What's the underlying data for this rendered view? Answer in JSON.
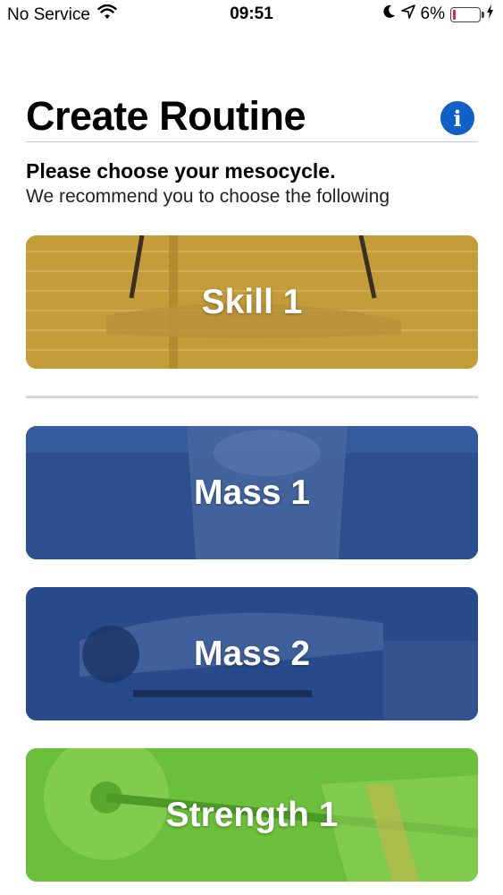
{
  "status_bar": {
    "carrier": "No Service",
    "time": "09:51",
    "battery_percent": "6%",
    "battery_level": 0.06
  },
  "header": {
    "title": "Create Routine"
  },
  "intro": {
    "heading": "Please choose your mesocycle.",
    "recommendation": "We recommend you to choose the following"
  },
  "recommended": [
    {
      "label": "Skill 1",
      "color": "#c49c3a"
    }
  ],
  "others": [
    {
      "label": "Mass 1",
      "color": "#2c4f8e"
    },
    {
      "label": "Mass 2",
      "color": "#274a8a"
    },
    {
      "label": "Strength 1",
      "color": "#6cbf3a"
    }
  ],
  "colors": {
    "accent": "#1160c8",
    "battery_low": "#e0243a"
  }
}
